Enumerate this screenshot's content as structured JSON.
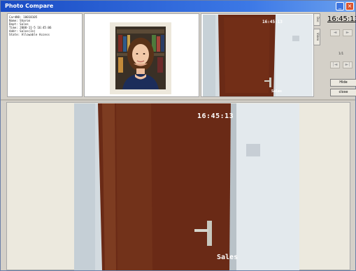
{
  "window": {
    "title": "Photo Compare",
    "min_glyph": "_",
    "close_glyph": "×"
  },
  "info": {
    "lines": [
      "CardNO: 10018105",
      "Name: Sharon",
      "Dept: Sales",
      "Time: 2008-11-5 16:45:06",
      "Addr: Sales(In)",
      "State: Allowable Access"
    ]
  },
  "camera": {
    "time": "16:45:13",
    "label": "Sales"
  },
  "tabs": [
    "Doc",
    "Video"
  ],
  "controls": {
    "time": "16:45:13",
    "counter": "1/1",
    "prev_glyph": "◄",
    "next_glyph": "►",
    "first_glyph": "|◄",
    "last_glyph": "►|",
    "hide_label": "Hide",
    "close_label": "close"
  },
  "colors": {
    "titlebar": "#1a4cc4",
    "door": "#6a2a16",
    "wall": "#d9e1e6"
  }
}
